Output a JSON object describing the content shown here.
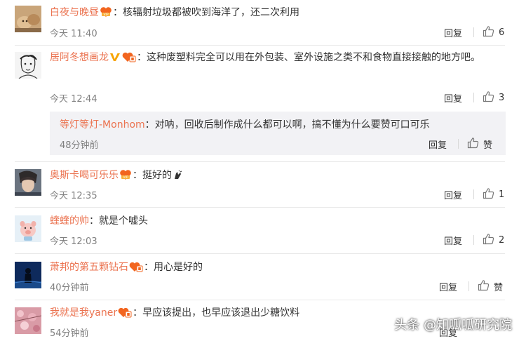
{
  "comments": [
    {
      "username": "白夜与晚昼",
      "separator": "：",
      "text": "核辐射垃圾都被吹到海洋了，还二次利用",
      "time": "今天 11:40",
      "reply_label": "回复",
      "likes": "6",
      "avatar": "cat-photo-avatar",
      "badge": "vip-heart-badge"
    },
    {
      "username": "居阿冬想画龙",
      "separator": "：",
      "text": "这种废塑料完全可以用在外包装、室外设施之类不和食物直接接触的地方吧。",
      "time": "今天 12:44",
      "reply_label": "回复",
      "likes": "3",
      "avatar": "sketch-face-avatar",
      "badge": "verified-v-badge",
      "sub_reply": {
        "username": "等灯等灯-Monhom",
        "separator": "：",
        "text": "对呐，回收后制作成什么都可以啊，搞不懂为什么要赞可口可乐",
        "time": "48分钟前",
        "reply_label": "回复",
        "like_label": "赞"
      }
    },
    {
      "username": "奥斯卡喝可乐乐",
      "separator": "：",
      "text": "挺好的",
      "time": "今天 12:35",
      "reply_label": "回复",
      "likes": "1",
      "avatar": "portrait-photo-avatar",
      "badge": "vip-heart-badge"
    },
    {
      "username": "蝰蝰的帅",
      "separator": "：",
      "text": "就是个嘘头",
      "time": "今天 12:03",
      "reply_label": "回复",
      "likes": "2",
      "avatar": "cartoon-pig-avatar"
    },
    {
      "username": "萧邦的第五颗钻石",
      "separator": "：",
      "text": "用心是好的",
      "time": "40分钟前",
      "reply_label": "回复",
      "like_label": "赞",
      "avatar": "blue-silhouette-avatar",
      "badge": "fan-heart-badge"
    },
    {
      "username": "我就是我yaner",
      "separator": "：",
      "text": "早应该提出，也早应该退出少糖饮料",
      "time": "54分钟前",
      "reply_label": "回复",
      "avatar": "pink-blossom-avatar",
      "badge": "fan-heart-badge"
    }
  ],
  "watermark": "头条 @知呱呱研究院",
  "colors": {
    "username": "#eb7350",
    "sub_username": "#eb7350",
    "meta": "#808080",
    "sub_bg": "#f2f2f5"
  }
}
